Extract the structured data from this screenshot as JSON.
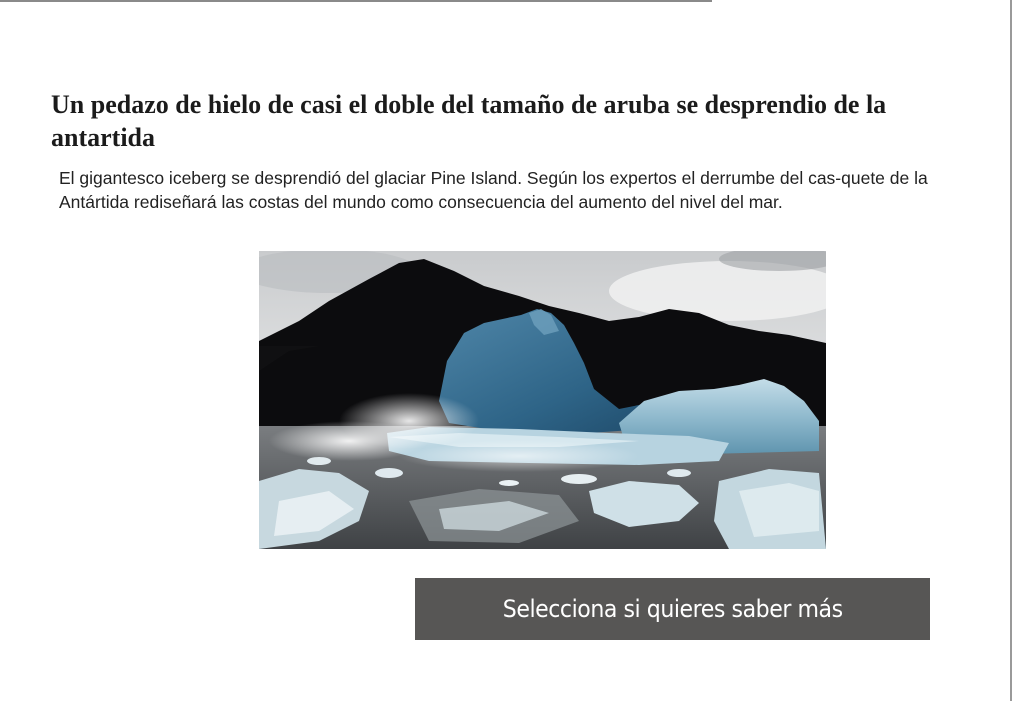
{
  "article": {
    "headline": "Un pedazo de hielo de casi el doble del tamaño de aruba se desprendio de la antartida",
    "summary": "El gigantesco iceberg se desprendió del glaciar Pine Island. Según los expertos el derrumbe del cas-quete de la Antártida rediseñará las costas del mundo como consecuencia del aumento del nivel del mar."
  },
  "cta": {
    "label": "Selecciona si quieres saber más",
    "background": "#575655"
  }
}
